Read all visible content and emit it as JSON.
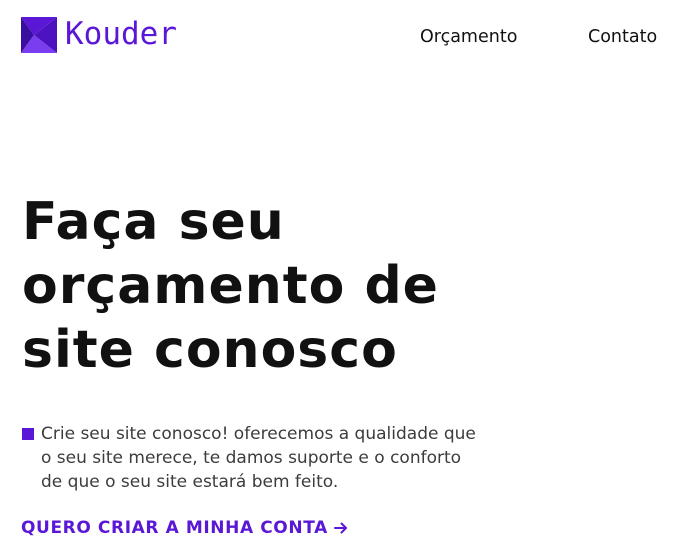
{
  "brand": {
    "name": "Kouder",
    "logo_icon": "kouder-logo-icon",
    "color": "#5b17d6"
  },
  "nav": {
    "items": [
      {
        "label": "Orçamento"
      },
      {
        "label": "Contato"
      }
    ]
  },
  "hero": {
    "title_lines": [
      "Faça seu",
      "orçamento de",
      "site conosco"
    ],
    "description_lines": [
      "Crie seu site conosco! oferecemos a qualidade que",
      "o seu site merece, te damos suporte e o conforto",
      "de que o seu site estará bem feito."
    ],
    "cta_label": "QUERO CRIAR A MINHA CONTA",
    "cta_icon": "arrow-right-icon"
  },
  "colors": {
    "accent": "#5b17d6",
    "text": "#111111",
    "muted": "#3c3c3c",
    "background": "#ffffff"
  }
}
